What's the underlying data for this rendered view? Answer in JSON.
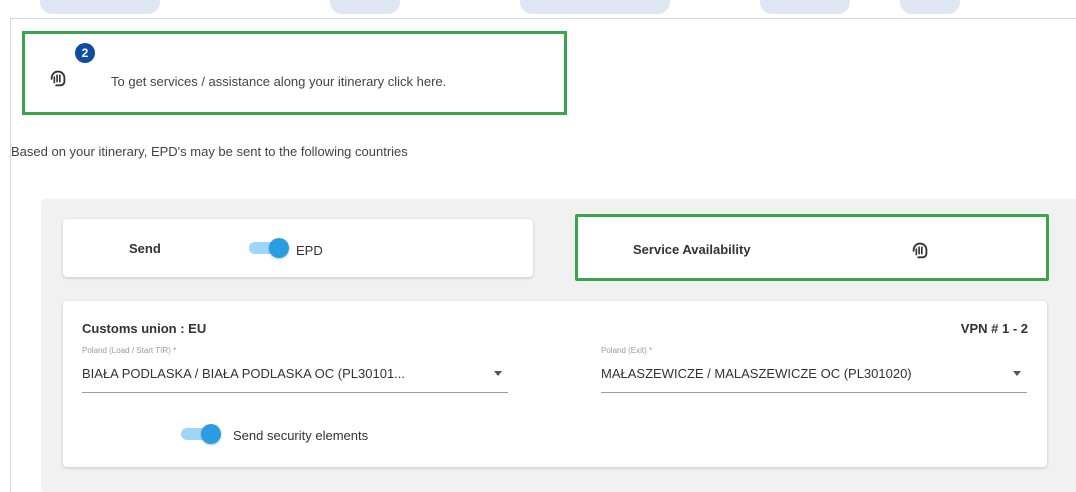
{
  "notice": {
    "badge_count": "2",
    "text": "To get services / assistance along your itinerary click here.",
    "icon": "hand-pointer-icon"
  },
  "intro": {
    "text": "Based on your itinerary, EPD's may be sent to the following countries"
  },
  "send_card": {
    "send_label": "Send",
    "epd_label": "EPD",
    "epd_enabled": true
  },
  "service_card": {
    "label": "Service Availability",
    "icon": "hand-pointer-icon"
  },
  "customs": {
    "union_label": "Customs union : EU",
    "vpn_label": "VPN # 1 - 2",
    "entry": {
      "label": "Poland (Load / Start TIR) *",
      "value": "BIAŁA PODLASKA / BIAŁA PODLASKA OC (PL30101..."
    },
    "exit": {
      "label": "Poland (Exit) *",
      "value": "MAŁASZEWICZE / MALASZEWICZE OC (PL301020)"
    },
    "security_label": "Send security elements",
    "security_enabled": true
  },
  "colors": {
    "highlight_border": "#3aa54a",
    "toggle_thumb": "#2a9de0",
    "toggle_track": "#9fd6f6",
    "badge": "#0d4f9e",
    "panel_bg": "#f1f1f1"
  }
}
